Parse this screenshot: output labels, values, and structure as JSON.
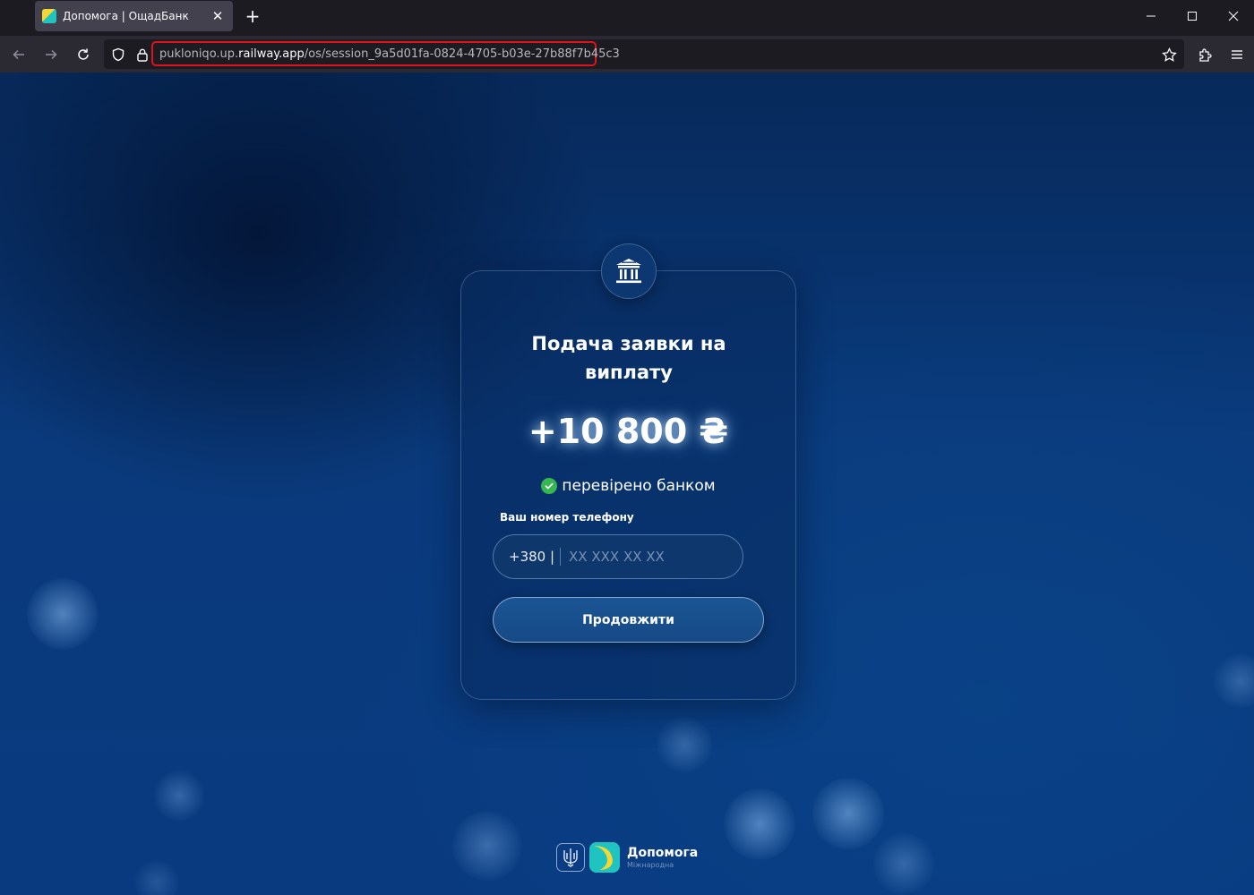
{
  "browser": {
    "tab_title": "Допомога | ОщадБанк",
    "tab_close": "✕",
    "new_tab": "+",
    "url_prefix": "pukloniqo.up.",
    "url_domain": "railway.app",
    "url_path": "/os/session_9a5d01fa-0824-4705-b03e-27b88f7b45c3",
    "highlight_color": "#e0121b"
  },
  "card": {
    "title": "Подача заявки на виплату",
    "amount": "+10 800 ₴",
    "verified_text": "перевірено банком",
    "phone_label": "Ваш номер телефону",
    "phone_prefix": "+380 |",
    "phone_placeholder": "XX XXX XX XX",
    "phone_value": "",
    "continue_label": "Продовжити"
  },
  "footer": {
    "brand_name": "Допомога",
    "brand_subtitle": "Міжнародна"
  },
  "colors": {
    "background": "#0a3a7c",
    "verified_check": "#35b852",
    "brand_yellow": "#f4d735",
    "brand_teal": "#1fc4c0"
  }
}
